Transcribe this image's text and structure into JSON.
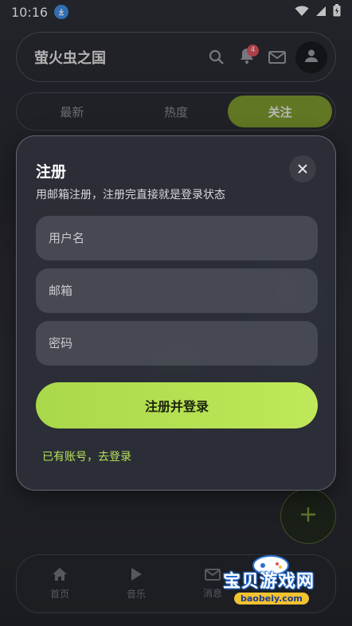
{
  "status_bar": {
    "time": "10:16",
    "icons": [
      "download-icon",
      "wifi-icon",
      "signal-icon",
      "battery-icon"
    ]
  },
  "header": {
    "title": "萤火虫之国",
    "notification_count": "4",
    "icons": [
      "search-icon",
      "bell-icon",
      "mail-icon",
      "user-icon"
    ]
  },
  "tabs": [
    {
      "label": "最新",
      "active": false
    },
    {
      "label": "热度",
      "active": false
    },
    {
      "label": "关注",
      "active": true
    }
  ],
  "register_dialog": {
    "title": "注册",
    "subtitle": "用邮箱注册，注册完直接就是登录状态",
    "username_placeholder": "用户名",
    "email_placeholder": "邮箱",
    "password_placeholder": "密码",
    "submit_label": "注册并登录",
    "login_link": "已有账号，去登录"
  },
  "bottom_nav": {
    "items": [
      {
        "label": "首页",
        "icon": "home-icon"
      },
      {
        "label": "音乐",
        "icon": "play-icon"
      },
      {
        "label": "消息",
        "icon": "mail-icon"
      }
    ]
  },
  "watermark": {
    "text": "宝贝游戏网",
    "url": "baobeiy.com"
  },
  "colors": {
    "accent": "#b3df50",
    "active_tab": "#7f9b2a",
    "badge": "#e0525b"
  }
}
